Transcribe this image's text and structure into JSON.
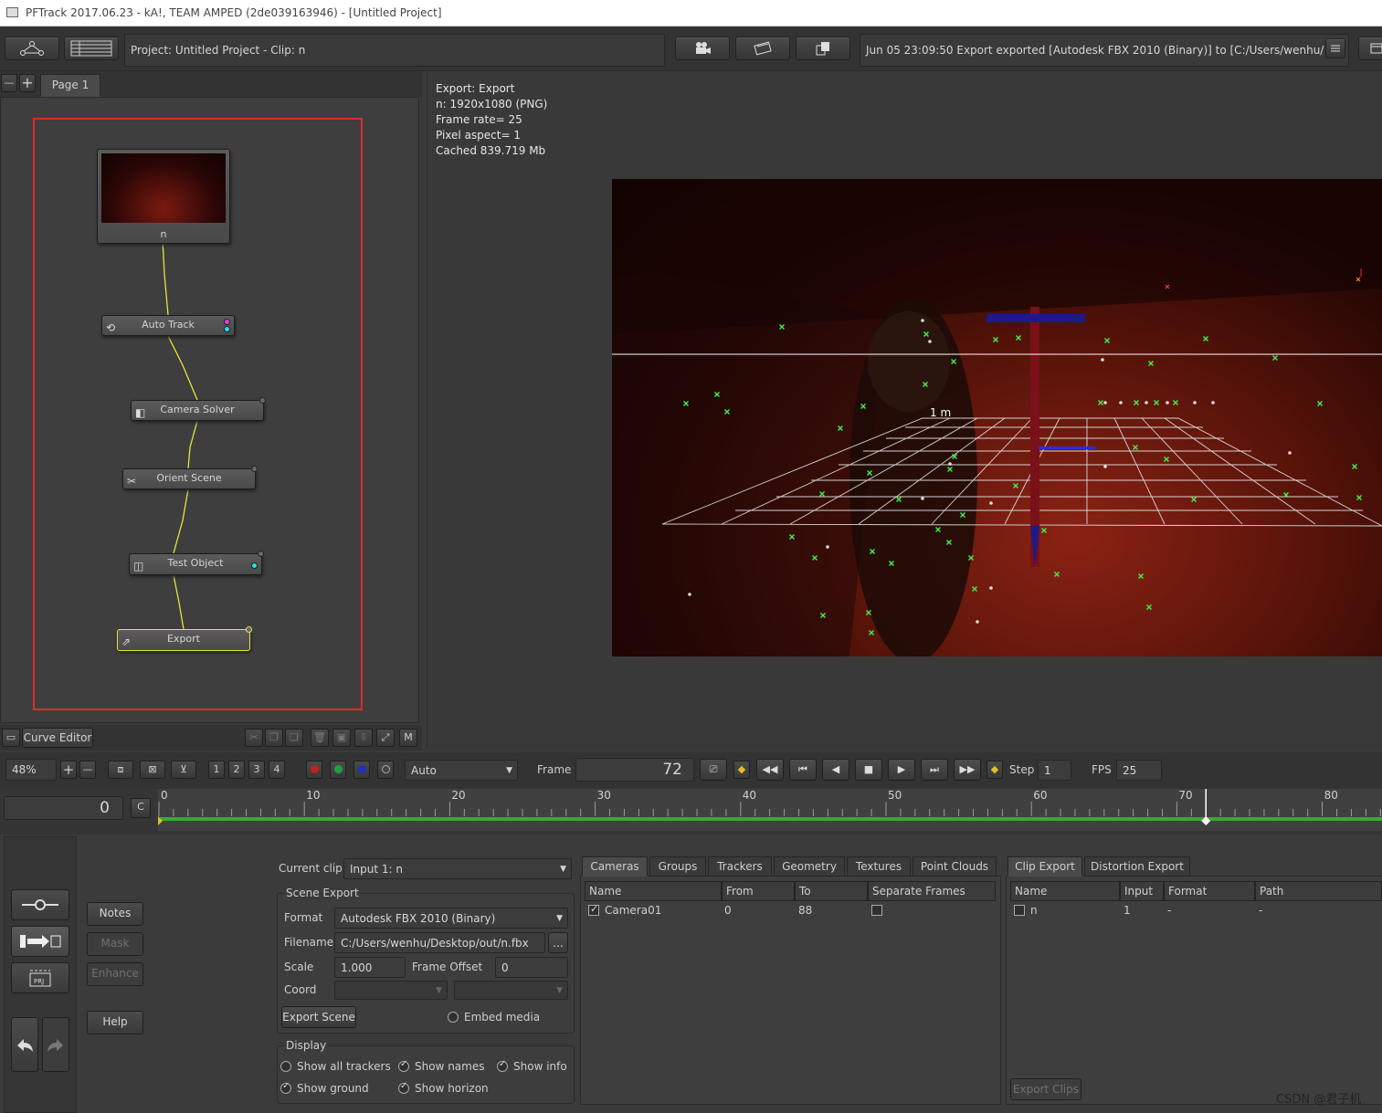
{
  "window": {
    "title": "PFTrack 2017.06.23 - kA!, TEAM AMPED (2de039163946) - [Untitled Project]"
  },
  "topbar": {
    "project_label": "Project: Untitled Project - Clip: n",
    "status_message": "Jun 05 23:09:50 Export exported [Autodesk FBX 2010 (Binary)] to [C:/Users/wenhu/ ..."
  },
  "node_editor": {
    "page_tab": "Page 1",
    "nodes": [
      {
        "label": "n"
      },
      {
        "label": "Auto Track"
      },
      {
        "label": "Camera Solver"
      },
      {
        "label": "Orient Scene"
      },
      {
        "label": "Test Object"
      },
      {
        "label": "Export"
      }
    ],
    "curve_editor_label": "Curve Editor",
    "m_label": "M"
  },
  "viewer": {
    "info_lines": [
      "Export: Export",
      "n: 1920x1080 (PNG)",
      "Frame rate= 25",
      "Pixel aspect= 1",
      "Cached 839.719 Mb"
    ],
    "ground_label": "1 m"
  },
  "controls": {
    "zoom": "48%",
    "view_buttons": [
      "1",
      "2",
      "3",
      "4"
    ],
    "mode_select": "Auto",
    "frame_label": "Frame",
    "frame_value": "72",
    "step_label": "Step",
    "step_value": "1",
    "fps_label": "FPS",
    "fps_value": "25"
  },
  "timeline": {
    "start_value": "0",
    "c_label": "C",
    "ticks": [
      "0",
      "10",
      "20",
      "30",
      "40",
      "50",
      "60",
      "70",
      "80"
    ],
    "current_frame": 72
  },
  "side_buttons": {
    "notes": "Notes",
    "mask": "Mask",
    "enhance": "Enhance",
    "help": "Help"
  },
  "export_panel": {
    "current_clip_label": "Current clip",
    "current_clip_value": "Input 1: n",
    "scene_export_title": "Scene Export",
    "format_label": "Format",
    "format_value": "Autodesk FBX 2010 (Binary)",
    "filename_label": "Filename",
    "filename_value": "C:/Users/wenhu/Desktop/out/n.fbx",
    "browse_label": "...",
    "scale_label": "Scale",
    "scale_value": "1.000",
    "frame_offset_label": "Frame Offset",
    "frame_offset_value": "0",
    "coord_label": "Coord",
    "export_scene_button": "Export Scene",
    "embed_media_label": "Embed media",
    "display_title": "Display",
    "display_options": {
      "show_all_trackers": "Show all trackers",
      "show_names": "Show names",
      "show_info": "Show info",
      "show_ground": "Show ground",
      "show_horizon": "Show horizon"
    }
  },
  "scene_tabs": {
    "tabs": [
      "Cameras",
      "Groups",
      "Trackers",
      "Geometry",
      "Textures",
      "Point Clouds"
    ],
    "columns": [
      "Name",
      "From",
      "To",
      "Separate Frames"
    ],
    "rows": [
      {
        "name": "Camera01",
        "from": "0",
        "to": "88"
      }
    ]
  },
  "clip_tabs": {
    "tabs": [
      "Clip Export",
      "Distortion Export"
    ],
    "columns": [
      "Name",
      "Input",
      "Format",
      "Path"
    ],
    "rows": [
      {
        "name": "n",
        "input": "1",
        "format": "-",
        "path": "-"
      }
    ],
    "export_clips_button": "Export Clips"
  },
  "watermark": "CSDN @君子机"
}
